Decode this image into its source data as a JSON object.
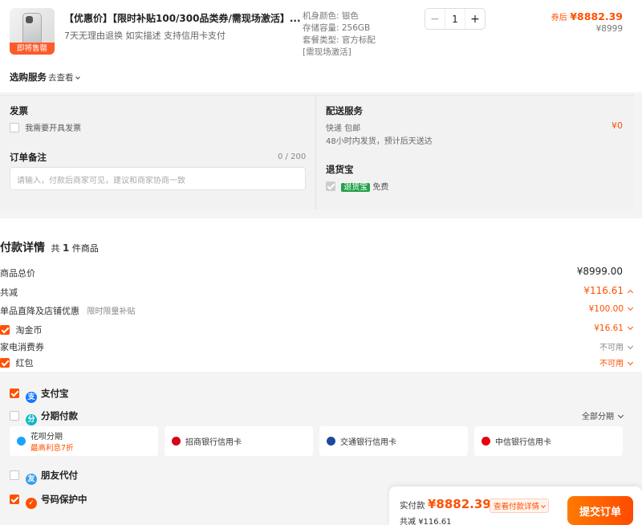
{
  "product": {
    "badge": "即将售罄",
    "title": "【优惠价】【限时补贴100/300品类券/需现场激活】...",
    "perks": "7天无理由退换  如实描述  支持信用卡支付",
    "specs": [
      "机身颜色: 银色",
      "存储容量: 256GB",
      "套餐类型: 官方标配",
      "[需现场激活]"
    ],
    "quantity": "1",
    "after_coupon_label": "券后",
    "after_coupon_price": "¥8882.39",
    "original_price": "¥8999"
  },
  "services": {
    "label": "选购服务",
    "link": "去查看"
  },
  "invoice": {
    "title": "发票",
    "checkbox_label": "我需要开具发票"
  },
  "note": {
    "title": "订单备注",
    "counter": "0 / 200",
    "placeholder": "请输入，付款后商家可见，建议和商家协商一致"
  },
  "delivery": {
    "title": "配送服务",
    "method": "快递 包邮",
    "eta": "48小时内发货，预计后天送达",
    "price": "¥0"
  },
  "return_insurance": {
    "title": "退货宝",
    "tag": "退货宝",
    "text": "免费"
  },
  "payment_details": {
    "title": "付款详情",
    "count_prefix": "共",
    "count": "1",
    "count_suffix": "件商品",
    "rows": [
      {
        "label": "商品总价",
        "value": "¥8999.00"
      },
      {
        "label": "共减",
        "value": "¥116.61"
      },
      {
        "label": "单品直降及店铺优惠",
        "sub": "限时限量补贴",
        "value": "¥100.00"
      },
      {
        "label": "淘金币",
        "value": "¥16.61"
      },
      {
        "label": "家电消费券",
        "value": "不可用"
      },
      {
        "label": "红包",
        "value": "不可用"
      }
    ]
  },
  "methods": {
    "alipay": "支付宝",
    "installment": "分期付款",
    "installment_all": "全部分期",
    "cards": [
      {
        "name": "花呗分期",
        "promo": "最高利息7折"
      },
      {
        "name": "招商银行信用卡"
      },
      {
        "name": "交通银行信用卡"
      },
      {
        "name": "中信银行信用卡"
      }
    ],
    "friend_pay": "朋友代付",
    "number_protect": "号码保护中"
  },
  "submit": {
    "pay_label": "实付款",
    "pay_amount": "¥8882.39",
    "detail_link": "查看付款详情",
    "saved_label": "共减",
    "saved_amount": "¥116.61",
    "button": "提交订单"
  },
  "colors": {
    "accent": "#ff5000",
    "alipay": "#1677ff",
    "huabei": "#1aa3ff",
    "green_tag": "#24a148"
  }
}
